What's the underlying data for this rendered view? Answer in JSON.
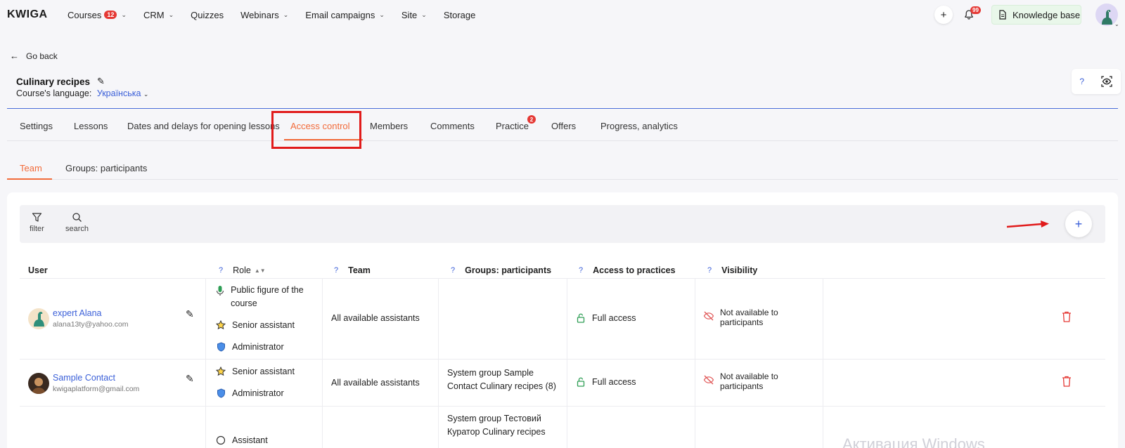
{
  "brand": {
    "logo": "KWIGA"
  },
  "nav": {
    "items": [
      {
        "label": "Courses",
        "badge": "12",
        "dropdown": true
      },
      {
        "label": "CRM",
        "dropdown": true
      },
      {
        "label": "Quizzes",
        "dropdown": false
      },
      {
        "label": "Webinars",
        "dropdown": true
      },
      {
        "label": "Email campaigns",
        "dropdown": true
      },
      {
        "label": "Site",
        "dropdown": true
      },
      {
        "label": "Storage",
        "dropdown": false
      }
    ],
    "add_label": "+",
    "notifications_badge": "99",
    "knowledge_base_label": "Knowledge base"
  },
  "header": {
    "go_back": "Go back",
    "course_title": "Culinary recipes",
    "language_label": "Course's language:",
    "language_value": "Українська",
    "help_label": "?"
  },
  "tabs": {
    "items": [
      "Settings",
      "Lessons",
      "Dates and delays for opening lessons",
      "Access control",
      "Members",
      "Comments",
      "Practice",
      "Offers",
      "Progress, analytics"
    ],
    "active": "Access control",
    "practice_badge": "2"
  },
  "subtabs": {
    "items": [
      "Team",
      "Groups: participants"
    ],
    "active": "Team"
  },
  "toolbar": {
    "filter_label": "filter",
    "search_label": "search",
    "add_label": "+"
  },
  "table": {
    "help_mark": "?",
    "columns": [
      "User",
      "Role",
      "Team",
      "Groups: participants",
      "Access to practices",
      "Visibility"
    ],
    "rows": [
      {
        "name": "expert Alana",
        "email": "alana13ty@yahoo.com",
        "roles": [
          "Public figure of the course",
          "Senior assistant",
          "Administrator"
        ],
        "team": "All available assistants",
        "groups": "",
        "access": "Full access",
        "visibility": "Not available to participants"
      },
      {
        "name": "Sample Contact",
        "email": "kwigaplatform@gmail.com",
        "roles": [
          "Senior assistant",
          "Administrator"
        ],
        "team": "All available assistants",
        "groups": "System group Sample Contact Culinary recipes (8)",
        "access": "Full access",
        "visibility": "Not available to participants"
      },
      {
        "roles": [
          "Assistant"
        ],
        "groups": "System group Тестовий Куратор Culinary recipes"
      }
    ]
  },
  "watermark": "Активация Windows",
  "colors": {
    "accent": "#f26b3a",
    "link": "#3a5fd8",
    "danger": "#e53935",
    "access": "#2e9e55"
  }
}
